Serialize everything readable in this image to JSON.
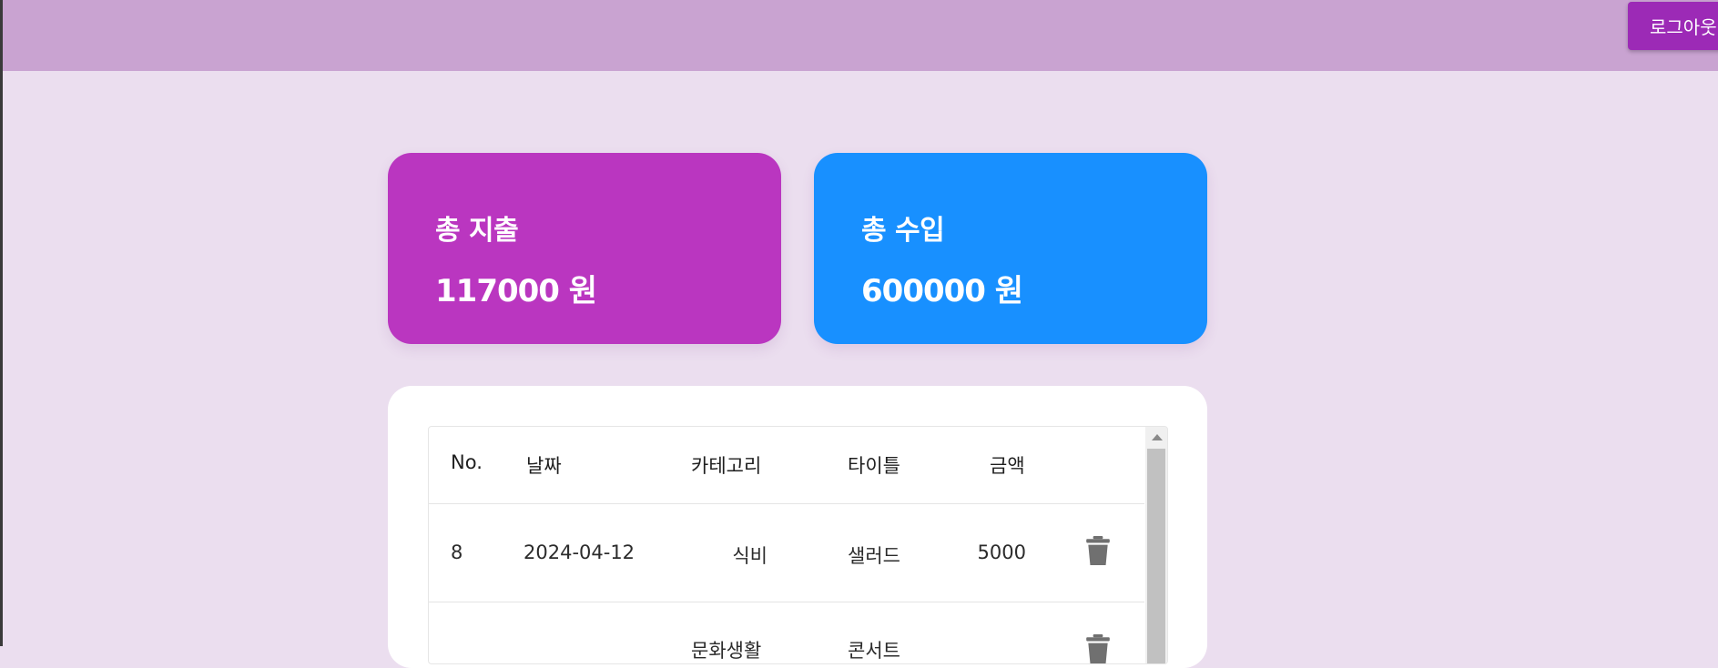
{
  "header": {
    "logout_label": "로그아웃"
  },
  "summary": {
    "expense": {
      "label": "총 지출",
      "value": "117000 원",
      "color": "#ba36c0"
    },
    "income": {
      "label": "총 수입",
      "value": "600000 원",
      "color": "#1890ff"
    }
  },
  "table": {
    "headers": {
      "no": "No.",
      "date": "날짜",
      "category": "카테고리",
      "title": "타이틀",
      "amount": "금액"
    },
    "rows": [
      {
        "no": "8",
        "date": "2024-04-12",
        "category": "식비",
        "title": "샐러드",
        "amount": "5000"
      },
      {
        "no": "",
        "date": "",
        "category": "문화생활",
        "title": "콘서트",
        "amount": ""
      }
    ]
  },
  "colors": {
    "topbar": "#c9a3d1",
    "background": "#ebdeef",
    "logout": "#9c2ab6"
  }
}
